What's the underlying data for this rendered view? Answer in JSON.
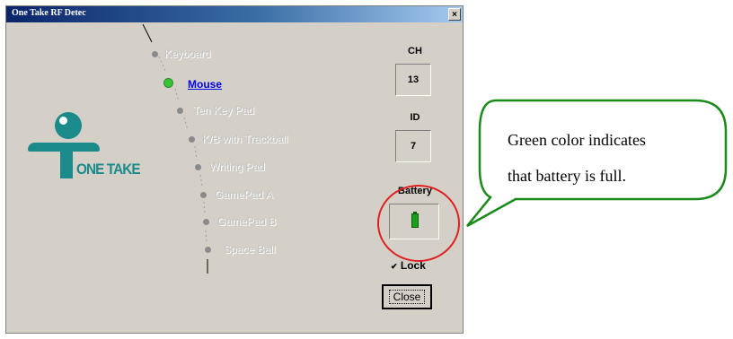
{
  "window": {
    "title": "One Take RF Detec",
    "close_glyph": "×"
  },
  "logo": {
    "text": "ONE TAKE",
    "color": "#1a8a8a"
  },
  "devices": [
    {
      "label": "Keyboard",
      "active": false
    },
    {
      "label": "Mouse",
      "active": true
    },
    {
      "label": "Ten Key Pad",
      "active": false
    },
    {
      "label": "K/B with Trackball",
      "active": false
    },
    {
      "label": "Writing Pad",
      "active": false
    },
    {
      "label": "GamePad A",
      "active": false
    },
    {
      "label": "GamePad B",
      "active": false
    },
    {
      "label": "Space Ball",
      "active": false
    }
  ],
  "channel": {
    "label": "CH",
    "value": "13"
  },
  "id": {
    "label": "ID",
    "value": "7"
  },
  "battery": {
    "label": "Battery",
    "status": "full",
    "color": "#1aa01a"
  },
  "lock": {
    "label": "Lock",
    "checked": true
  },
  "close_button": {
    "label": "Close"
  },
  "callout": {
    "line1": "Green color indicates",
    "line2": "that battery is full.",
    "border_color": "#1a8a1a",
    "circle_color": "#e02020"
  }
}
